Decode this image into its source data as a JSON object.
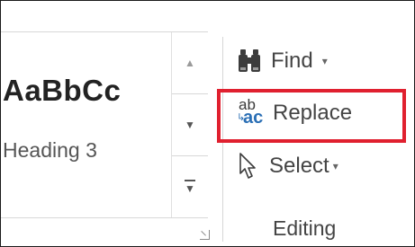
{
  "styles_gallery": {
    "sample_text": "AaBbCc",
    "style_name": "Heading 3",
    "scroll_up_glyph": "▲",
    "scroll_down_glyph": "▼",
    "more_glyph": "▼"
  },
  "editing": {
    "find": {
      "label": "Find",
      "icon": "binoculars-icon",
      "arrow": "▾"
    },
    "replace": {
      "label": "Replace",
      "icon": "replace-icon",
      "icon_top": "ab",
      "icon_bottom": "ac",
      "icon_arrow": "↳"
    },
    "select": {
      "label": "Select",
      "icon": "cursor-arrow-icon",
      "arrow": "▾"
    },
    "group_label": "Editing"
  },
  "colors": {
    "highlight": "#e0202f",
    "replace_icon_accent": "#2b6fb5"
  }
}
